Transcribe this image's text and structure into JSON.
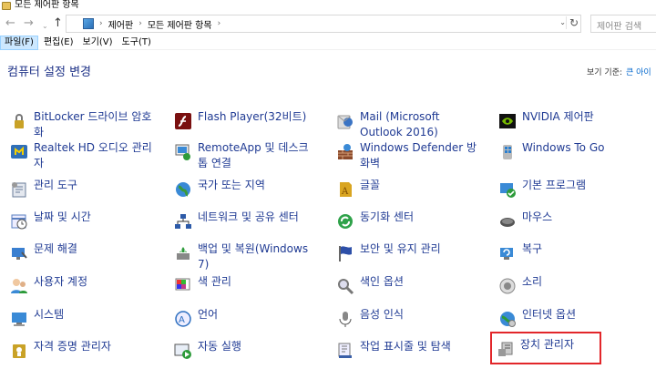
{
  "window": {
    "title": "모든 제어판 항목"
  },
  "address": {
    "crumbs": [
      "제어판",
      "모든 제어판 항목"
    ],
    "search_placeholder": "제어판 검색"
  },
  "nav": {
    "back": "←",
    "forward": "→",
    "dropdown": "⌄",
    "up": "↑",
    "refresh": "↻"
  },
  "menu": [
    "파일(F)",
    "편집(E)",
    "보기(V)",
    "도구(T)"
  ],
  "header": {
    "title": "컴퓨터 설정 변경",
    "view_by_label": "보기 기준:",
    "view_by_value": "큰 아이"
  },
  "items": [
    {
      "label": "BitLocker 드라이브 암호화",
      "icon": "bitlocker-icon",
      "color": "#c9a227"
    },
    {
      "label": "Flash Player(32비트)",
      "icon": "flash-icon",
      "color": "#7a1010"
    },
    {
      "label": "Mail (Microsoft Outlook 2016)",
      "icon": "mail-icon",
      "color": "#3b74c4"
    },
    {
      "label": "NVIDIA 제어판",
      "icon": "nvidia-icon",
      "color": "#76b900"
    },
    {
      "label": "Realtek HD 오디오 관리자",
      "icon": "realtek-audio-icon",
      "color": "#2f6fb8"
    },
    {
      "label": "RemoteApp 및 데스크톱 연결",
      "icon": "remoteapp-icon",
      "color": "#3a8ad6"
    },
    {
      "label": "Windows Defender 방화벽",
      "icon": "firewall-icon",
      "color": "#8b4a2b"
    },
    {
      "label": "Windows To Go",
      "icon": "windows-to-go-icon",
      "color": "#2a7fd0"
    },
    {
      "label": "관리 도구",
      "icon": "admin-tools-icon",
      "color": "#6a7c99"
    },
    {
      "label": "국가 또는 지역",
      "icon": "region-icon",
      "color": "#3a8ad6"
    },
    {
      "label": "글꼴",
      "icon": "fonts-icon",
      "color": "#d9a521"
    },
    {
      "label": "기본 프로그램",
      "icon": "default-programs-icon",
      "color": "#2d9b3a"
    },
    {
      "label": "날짜 및 시간",
      "icon": "date-time-icon",
      "color": "#5a7fc0"
    },
    {
      "label": "네트워크 및 공유 센터",
      "icon": "network-icon",
      "color": "#2d5aa8"
    },
    {
      "label": "동기화 센터",
      "icon": "sync-icon",
      "color": "#2fa24a"
    },
    {
      "label": "마우스",
      "icon": "mouse-icon",
      "color": "#555555"
    },
    {
      "label": "문제 해결",
      "icon": "troubleshoot-icon",
      "color": "#3a7fd0"
    },
    {
      "label": "백업 및 복원(Windows 7)",
      "icon": "backup-icon",
      "color": "#2d9b3a"
    },
    {
      "label": "보안 및 유지 관리",
      "icon": "security-flag-icon",
      "color": "#2d4fa8"
    },
    {
      "label": "복구",
      "icon": "recovery-icon",
      "color": "#3a8ad6"
    },
    {
      "label": "사용자 계정",
      "icon": "user-accounts-icon",
      "color": "#3a8ad6"
    },
    {
      "label": "색 관리",
      "icon": "color-management-icon",
      "color": "#c03a8a"
    },
    {
      "label": "색인 옵션",
      "icon": "indexing-icon",
      "color": "#777777"
    },
    {
      "label": "소리",
      "icon": "sound-icon",
      "color": "#888888"
    },
    {
      "label": "시스템",
      "icon": "system-icon",
      "color": "#3a8ad6"
    },
    {
      "label": "언어",
      "icon": "language-icon",
      "color": "#2d6fc0"
    },
    {
      "label": "음성 인식",
      "icon": "speech-icon",
      "color": "#888888"
    },
    {
      "label": "인터넷 옵션",
      "icon": "internet-options-icon",
      "color": "#2d9b3a"
    },
    {
      "label": "자격 증명 관리자",
      "icon": "credential-icon",
      "color": "#c9a227"
    },
    {
      "label": "자동 실행",
      "icon": "autoplay-icon",
      "color": "#2d9b3a"
    },
    {
      "label": "작업 표시줄 및 탐색",
      "icon": "taskbar-icon",
      "color": "#3a5fa8"
    },
    {
      "label": "장치 관리자",
      "icon": "device-manager-icon",
      "color": "#777777",
      "selected": true
    }
  ]
}
